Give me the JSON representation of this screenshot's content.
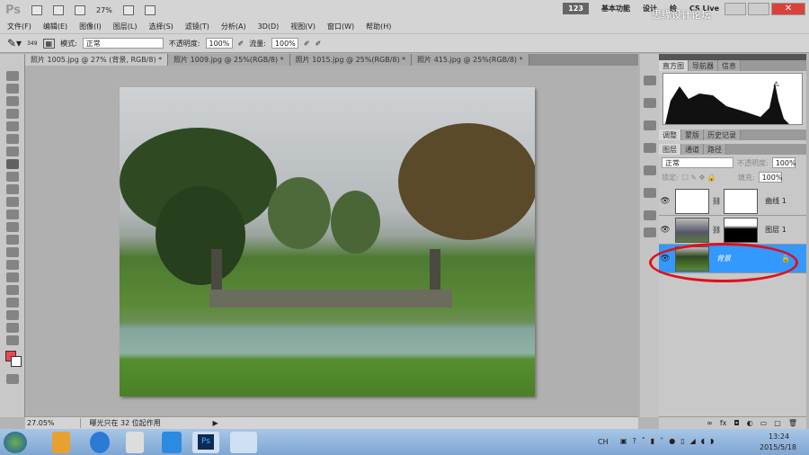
{
  "app": {
    "logo": "Ps",
    "zoom": "27%"
  },
  "workspace": {
    "counter": "123",
    "items": [
      "基本功能",
      "设计",
      "绘"
    ],
    "cs_live": "CS Live"
  },
  "watermark": "思缘设计论坛 WWW.MISSYUAN.COM",
  "menu": [
    "文件(F)",
    "编辑(E)",
    "图像(I)",
    "图层(L)",
    "选择(S)",
    "滤镜(T)",
    "分析(A)",
    "3D(D)",
    "视图(V)",
    "窗口(W)",
    "帮助(H)"
  ],
  "options": {
    "brush_size": "349",
    "mode_label": "模式:",
    "mode_value": "正常",
    "opacity_label": "不透明度:",
    "opacity_value": "100%",
    "flow_label": "流量:",
    "flow_value": "100%"
  },
  "doc_tabs": [
    "照片 1005.jpg @ 27% (背景, RGB/8) *",
    "照片 1009.jpg @ 25%(RGB/8) *",
    "照片 1015.jpg @ 25%(RGB/8) *",
    "照片 415.jpg @ 25%(RGB/8) *"
  ],
  "status": {
    "zoom": "27.05%",
    "message": "曝光只在 32 位起作用"
  },
  "panels": {
    "top_tabs": [
      "直方图",
      "导航器",
      "信息"
    ],
    "mid_tabs": [
      "调整",
      "蒙版",
      "历史记录"
    ],
    "layer_tabs": [
      "图层",
      "通道",
      "路径"
    ],
    "blend_mode": "正常",
    "opacity_label": "不透明度:",
    "opacity": "100%",
    "lock_label": "锁定:",
    "fill_label": "填充:",
    "fill": "100%",
    "layers": [
      {
        "name": "曲线 1",
        "selected": false
      },
      {
        "name": "图层 1",
        "selected": false
      },
      {
        "name": "背景",
        "selected": true
      }
    ]
  },
  "colors": {
    "foreground": "#ee4455",
    "selection": "#3399ff",
    "highlight_ellipse": "#e0101a"
  },
  "taskbar": {
    "time": "13:24",
    "date": "2015/5/18",
    "lang": "CH"
  }
}
